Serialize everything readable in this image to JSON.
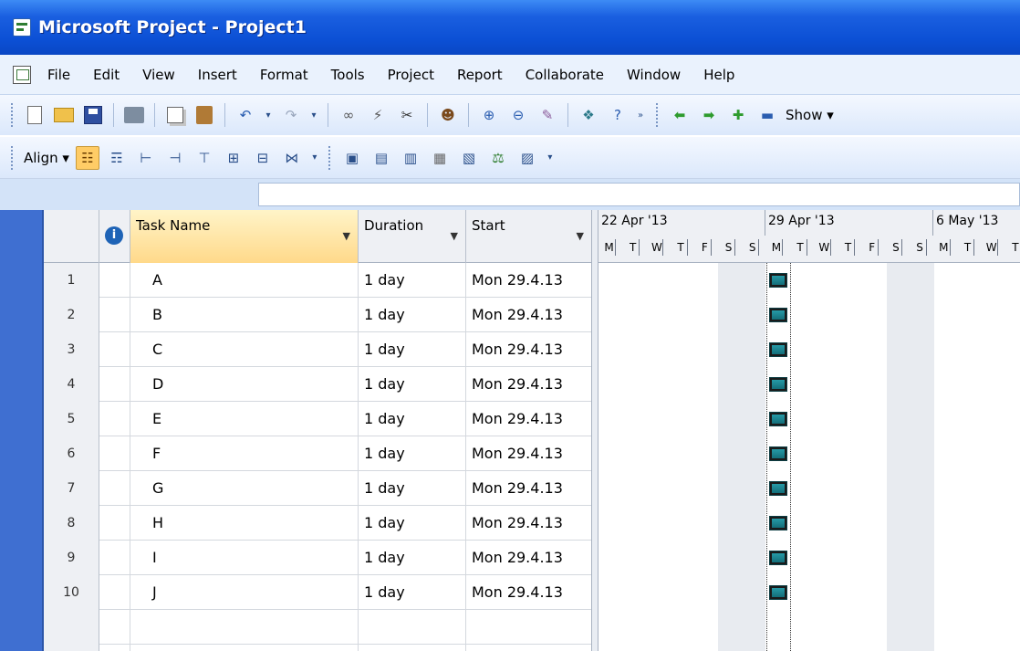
{
  "window": {
    "title": "Microsoft Project - Project1"
  },
  "menu": [
    "File",
    "Edit",
    "View",
    "Insert",
    "Format",
    "Tools",
    "Project",
    "Report",
    "Collaborate",
    "Window",
    "Help"
  ],
  "toolbar": {
    "show_label": "Show ▾"
  },
  "formatting_toolbar": {
    "align_label": "Align ▾"
  },
  "grid": {
    "columns": {
      "task_name": "Task Name",
      "duration": "Duration",
      "start": "Start"
    },
    "rows": [
      {
        "id": "1",
        "name": "A",
        "duration": "1 day",
        "start": "Mon 29.4.13"
      },
      {
        "id": "2",
        "name": "B",
        "duration": "1 day",
        "start": "Mon 29.4.13"
      },
      {
        "id": "3",
        "name": "C",
        "duration": "1 day",
        "start": "Mon 29.4.13"
      },
      {
        "id": "4",
        "name": "D",
        "duration": "1 day",
        "start": "Mon 29.4.13"
      },
      {
        "id": "5",
        "name": "E",
        "duration": "1 day",
        "start": "Mon 29.4.13"
      },
      {
        "id": "6",
        "name": "F",
        "duration": "1 day",
        "start": "Mon 29.4.13"
      },
      {
        "id": "7",
        "name": "G",
        "duration": "1 day",
        "start": "Mon 29.4.13"
      },
      {
        "id": "8",
        "name": "H",
        "duration": "1 day",
        "start": "Mon 29.4.13"
      },
      {
        "id": "9",
        "name": "I",
        "duration": "1 day",
        "start": "Mon 29.4.13"
      },
      {
        "id": "10",
        "name": "J",
        "duration": "1 day",
        "start": "Mon 29.4.13"
      }
    ]
  },
  "gantt": {
    "weeks": [
      "22 Apr '13",
      "29 Apr '13",
      "6 May '13"
    ],
    "days": [
      "M",
      "T",
      "W",
      "T",
      "F",
      "S",
      "S",
      "M",
      "T",
      "W",
      "T",
      "F",
      "S",
      "S",
      "M",
      "T",
      "W",
      "T"
    ],
    "bar_color": "#2aa3b0"
  }
}
